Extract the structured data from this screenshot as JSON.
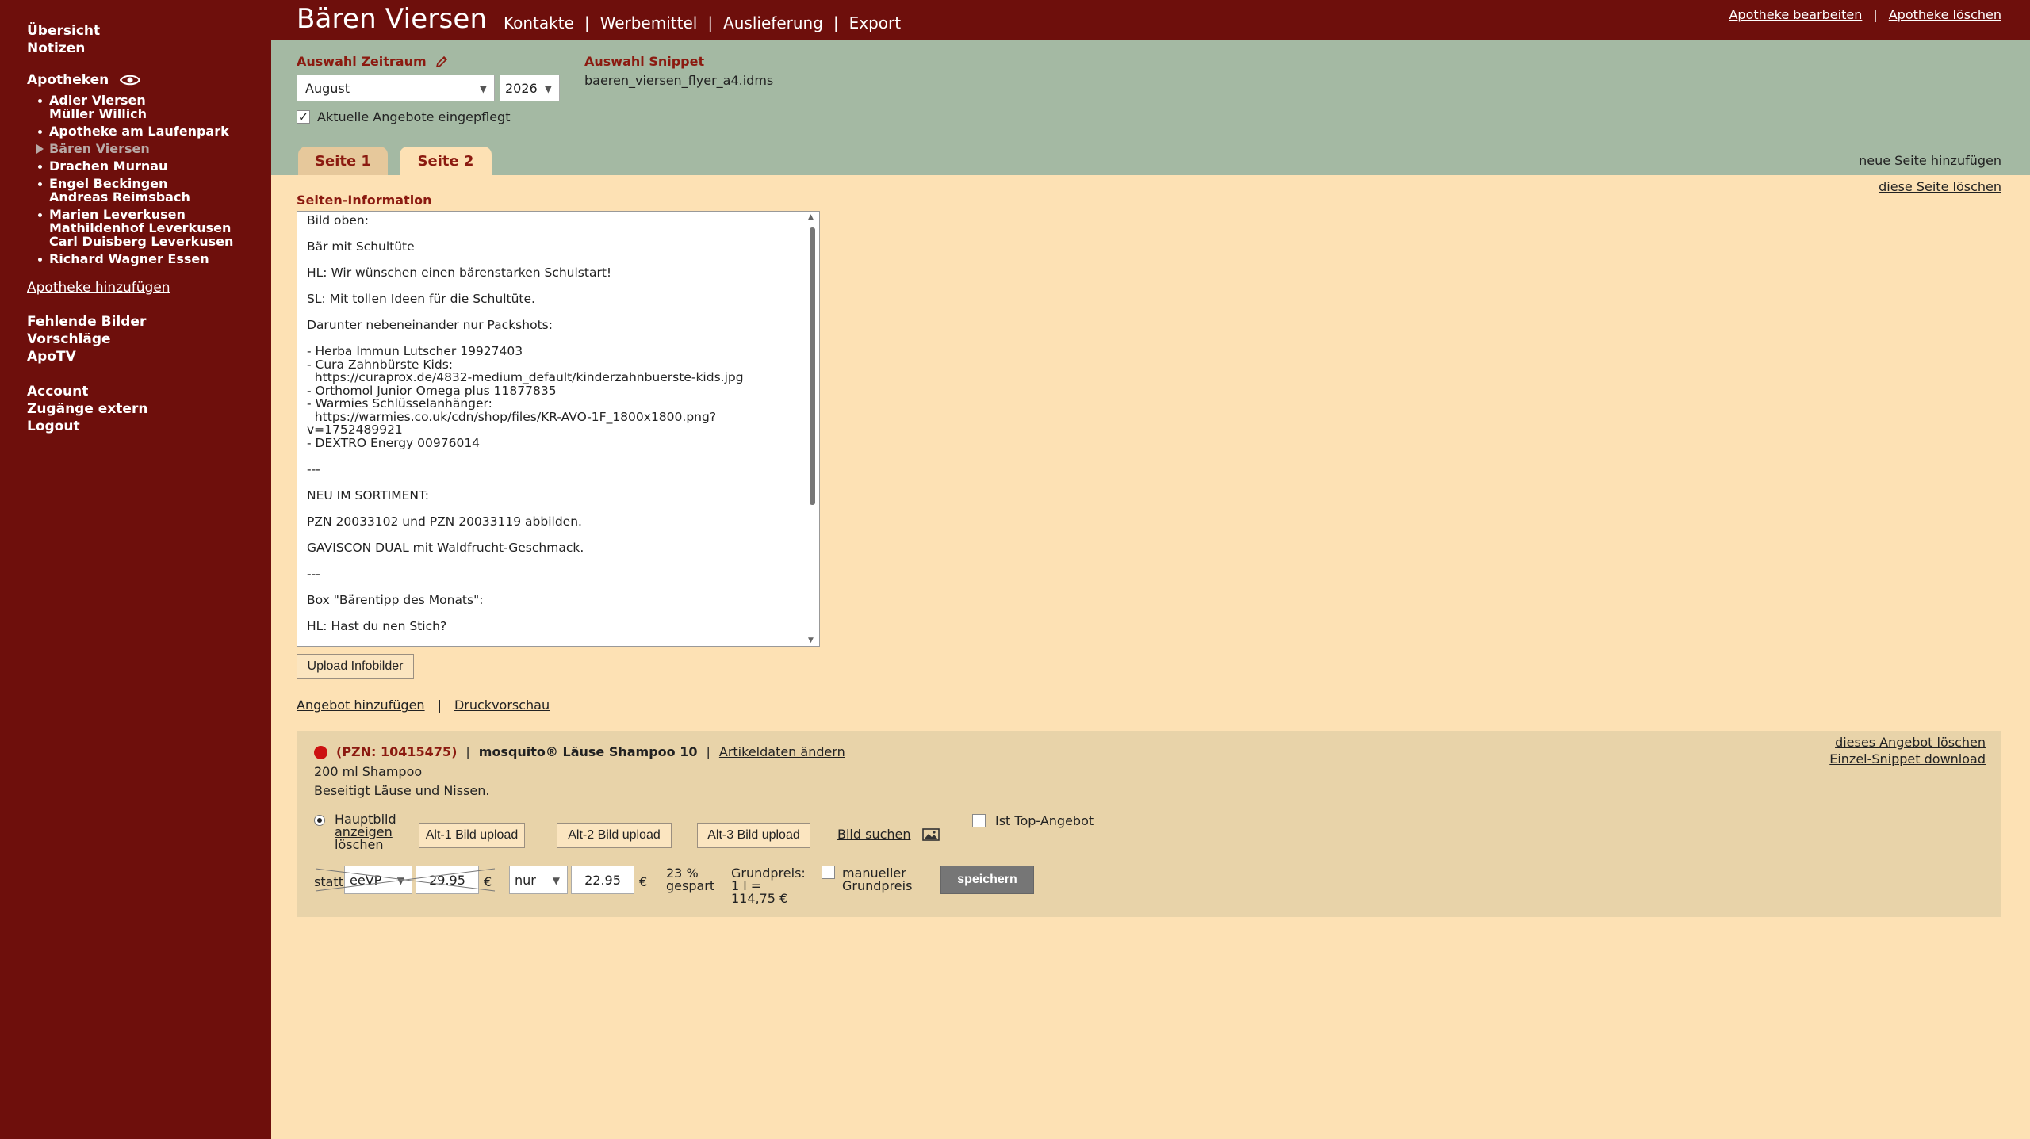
{
  "sidebar": {
    "top": [
      "Übersicht",
      "Notizen"
    ],
    "apotheken_label": "Apotheken",
    "apotheken": [
      {
        "label": "Adler Viersen\nMüller Willich",
        "active": false
      },
      {
        "label": "Apotheke am Laufenpark",
        "active": false
      },
      {
        "label": "Bären Viersen",
        "active": true
      },
      {
        "label": "Drachen Murnau",
        "active": false
      },
      {
        "label": "Engel Beckingen\nAndreas Reimsbach",
        "active": false
      },
      {
        "label": "Marien Leverkusen\nMathildenhof Leverkusen\nCarl Duisberg Leverkusen",
        "active": false
      },
      {
        "label": "Richard Wagner Essen",
        "active": false
      }
    ],
    "add_link": "Apotheke hinzufügen",
    "middle": [
      "Fehlende Bilder",
      "Vorschläge",
      "ApoTV"
    ],
    "bottom": [
      "Account",
      "Zugänge extern",
      "Logout"
    ]
  },
  "header": {
    "title": "Bären Viersen",
    "nav": [
      "Kontakte",
      "Werbemittel",
      "Auslieferung",
      "Export"
    ],
    "nav_sep": "|",
    "right_links": [
      "Apotheke bearbeiten",
      "Apotheke löschen"
    ]
  },
  "controls": {
    "zeitraum_label": "Auswahl Zeitraum",
    "month": "August",
    "year": "2026",
    "snippet_label": "Auswahl Snippet",
    "snippet_value": "baeren_viersen_flyer_a4.idms",
    "angebote_label": "Aktuelle Angebote eingepflegt",
    "angebote_checked": true,
    "check_mark": "✓",
    "tabs": [
      "Seite 1",
      "Seite 2"
    ],
    "active_tab": "Seite 2",
    "neue_seite": "neue Seite hinzufügen",
    "seite_loeschen": "diese Seite löschen"
  },
  "main": {
    "seiten_info_label": "Seiten-Information",
    "infotext": "Bild oben:\n\nBär mit Schultüte\n\nHL: Wir wünschen einen bärenstarken Schulstart!\n\nSL: Mit tollen Ideen für die Schultüte.\n\nDarunter nebeneinander nur Packshots:\n\n- Herba Immun Lutscher 19927403\n- Cura Zahnbürste Kids:\n  https://curaprox.de/4832-medium_default/kinderzahnbuerste-kids.jpg\n- Orthomol Junior Omega plus 11877835\n- Warmies Schlüsselanhänger:\n  https://warmies.co.uk/cdn/shop/files/KR-AVO-1F_1800x1800.png?v=1752489921\n- DEXTRO Energy 00976014\n\n---\n\nNEU IM SORTIMENT:\n\nPZN 20033102 und PZN 20033119 abbilden.\n\nGAVISCON DUAL mit Waldfrucht-Geschmack.\n\n---\n\nBox \"Bärentipp des Monats\":\n\nHL: Hast du nen Stich?\n\nRoter, heißer Kopf, Übelkeit oder Schwindel. An heißen Sonnentagen holt man sich",
    "upload_infobilder": "Upload Infobilder",
    "angebot_hinzufuegen": "Angebot hinzufügen",
    "druckvorschau": "Druckvorschau"
  },
  "offer": {
    "status_color": "#cc1111",
    "pzn": "(PZN: 10415475)",
    "product_name": "mosquito® Läuse Shampoo 10",
    "artikeldaten_link": "Artikeldaten ändern",
    "line2": "200 ml Shampoo",
    "line3": "Beseitigt Läuse und Nissen.",
    "delete_link": "dieses Angebot löschen",
    "snippet_download": "Einzel-Snippet download",
    "hauptbild_label": "Hauptbild",
    "anzeigen": "anzeigen",
    "loeschen": "löschen",
    "alt1": "Alt-1 Bild upload",
    "alt2": "Alt-2 Bild upload",
    "alt3": "Alt-3 Bild upload",
    "bild_suchen": "Bild suchen",
    "top_angebot_label": "Ist Top-Angebot",
    "statt_label": "statt",
    "statt_select": "eeVP",
    "statt_price": "29.95",
    "currency": "€",
    "nur_select": "nur",
    "nur_price": "22.95",
    "gespart_line1": "23 %",
    "gespart_line2": "gespart",
    "grundpreis_line1": "Grundpreis:",
    "grundpreis_line2": "1 l = 114,75 €",
    "manuell_line1": "manueller",
    "manuell_line2": "Grundpreis",
    "speichern": "speichern"
  },
  "colors": {
    "sidebar_bg": "#6e0f0c",
    "controls_bg": "#a4b9a3",
    "content_bg": "#fde1b4",
    "offer_bg": "#e8d3a9",
    "accent_red": "#8b1a10"
  }
}
